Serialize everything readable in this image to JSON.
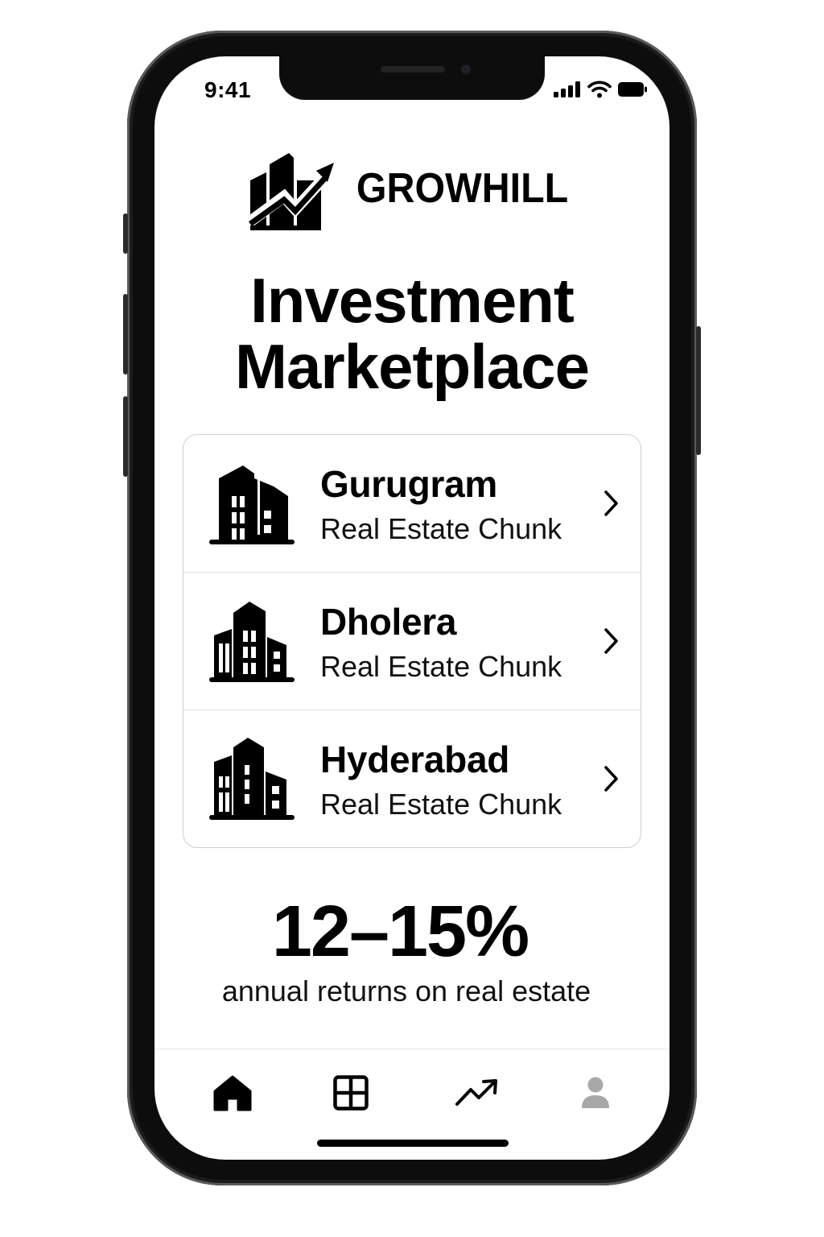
{
  "status_bar": {
    "time": "9:41",
    "icons": [
      "signal-icon",
      "wifi-icon",
      "battery-icon"
    ]
  },
  "brand": {
    "name": "GROWHILL",
    "logo_icon": "growth-buildings-logo"
  },
  "page_title": {
    "line1": "Investment",
    "line2": "Marketplace"
  },
  "listings": [
    {
      "city": "Gurugram",
      "subtitle": "Real Estate Chunk",
      "icon": "building-icon"
    },
    {
      "city": "Dholera",
      "subtitle": "Real Estate Chunk",
      "icon": "building-icon"
    },
    {
      "city": "Hyderabad",
      "subtitle": "Real Estate Chunk",
      "icon": "building-icon"
    }
  ],
  "returns": {
    "value": "12–15%",
    "label": "annual returns on real estate"
  },
  "tab_bar": {
    "tabs": [
      {
        "name": "home",
        "icon": "home-icon",
        "active": true
      },
      {
        "name": "grid",
        "icon": "grid-icon",
        "active": false
      },
      {
        "name": "trends",
        "icon": "trending-up-icon",
        "active": false
      },
      {
        "name": "profile",
        "icon": "profile-icon",
        "active": false
      }
    ]
  },
  "colors": {
    "text": "#000000",
    "background": "#ffffff",
    "inactive_icon": "#a8a8a8",
    "border": "#cfcfcf"
  }
}
